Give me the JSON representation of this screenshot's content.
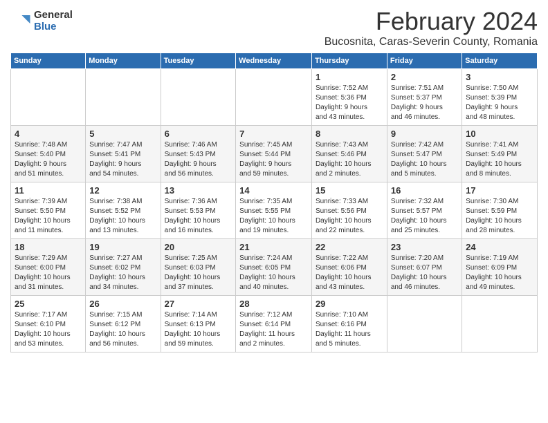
{
  "header": {
    "logo": {
      "general": "General",
      "blue": "Blue"
    },
    "title": "February 2024",
    "subtitle": "Bucosnita, Caras-Severin County, Romania"
  },
  "calendar": {
    "days": [
      "Sunday",
      "Monday",
      "Tuesday",
      "Wednesday",
      "Thursday",
      "Friday",
      "Saturday"
    ],
    "weeks": [
      {
        "cells": [
          {
            "date": "",
            "info": ""
          },
          {
            "date": "",
            "info": ""
          },
          {
            "date": "",
            "info": ""
          },
          {
            "date": "",
            "info": ""
          },
          {
            "date": "1",
            "info": "Sunrise: 7:52 AM\nSunset: 5:36 PM\nDaylight: 9 hours\nand 43 minutes."
          },
          {
            "date": "2",
            "info": "Sunrise: 7:51 AM\nSunset: 5:37 PM\nDaylight: 9 hours\nand 46 minutes."
          },
          {
            "date": "3",
            "info": "Sunrise: 7:50 AM\nSunset: 5:39 PM\nDaylight: 9 hours\nand 48 minutes."
          }
        ]
      },
      {
        "cells": [
          {
            "date": "4",
            "info": "Sunrise: 7:48 AM\nSunset: 5:40 PM\nDaylight: 9 hours\nand 51 minutes."
          },
          {
            "date": "5",
            "info": "Sunrise: 7:47 AM\nSunset: 5:41 PM\nDaylight: 9 hours\nand 54 minutes."
          },
          {
            "date": "6",
            "info": "Sunrise: 7:46 AM\nSunset: 5:43 PM\nDaylight: 9 hours\nand 56 minutes."
          },
          {
            "date": "7",
            "info": "Sunrise: 7:45 AM\nSunset: 5:44 PM\nDaylight: 9 hours\nand 59 minutes."
          },
          {
            "date": "8",
            "info": "Sunrise: 7:43 AM\nSunset: 5:46 PM\nDaylight: 10 hours\nand 2 minutes."
          },
          {
            "date": "9",
            "info": "Sunrise: 7:42 AM\nSunset: 5:47 PM\nDaylight: 10 hours\nand 5 minutes."
          },
          {
            "date": "10",
            "info": "Sunrise: 7:41 AM\nSunset: 5:49 PM\nDaylight: 10 hours\nand 8 minutes."
          }
        ]
      },
      {
        "cells": [
          {
            "date": "11",
            "info": "Sunrise: 7:39 AM\nSunset: 5:50 PM\nDaylight: 10 hours\nand 11 minutes."
          },
          {
            "date": "12",
            "info": "Sunrise: 7:38 AM\nSunset: 5:52 PM\nDaylight: 10 hours\nand 13 minutes."
          },
          {
            "date": "13",
            "info": "Sunrise: 7:36 AM\nSunset: 5:53 PM\nDaylight: 10 hours\nand 16 minutes."
          },
          {
            "date": "14",
            "info": "Sunrise: 7:35 AM\nSunset: 5:55 PM\nDaylight: 10 hours\nand 19 minutes."
          },
          {
            "date": "15",
            "info": "Sunrise: 7:33 AM\nSunset: 5:56 PM\nDaylight: 10 hours\nand 22 minutes."
          },
          {
            "date": "16",
            "info": "Sunrise: 7:32 AM\nSunset: 5:57 PM\nDaylight: 10 hours\nand 25 minutes."
          },
          {
            "date": "17",
            "info": "Sunrise: 7:30 AM\nSunset: 5:59 PM\nDaylight: 10 hours\nand 28 minutes."
          }
        ]
      },
      {
        "cells": [
          {
            "date": "18",
            "info": "Sunrise: 7:29 AM\nSunset: 6:00 PM\nDaylight: 10 hours\nand 31 minutes."
          },
          {
            "date": "19",
            "info": "Sunrise: 7:27 AM\nSunset: 6:02 PM\nDaylight: 10 hours\nand 34 minutes."
          },
          {
            "date": "20",
            "info": "Sunrise: 7:25 AM\nSunset: 6:03 PM\nDaylight: 10 hours\nand 37 minutes."
          },
          {
            "date": "21",
            "info": "Sunrise: 7:24 AM\nSunset: 6:05 PM\nDaylight: 10 hours\nand 40 minutes."
          },
          {
            "date": "22",
            "info": "Sunrise: 7:22 AM\nSunset: 6:06 PM\nDaylight: 10 hours\nand 43 minutes."
          },
          {
            "date": "23",
            "info": "Sunrise: 7:20 AM\nSunset: 6:07 PM\nDaylight: 10 hours\nand 46 minutes."
          },
          {
            "date": "24",
            "info": "Sunrise: 7:19 AM\nSunset: 6:09 PM\nDaylight: 10 hours\nand 49 minutes."
          }
        ]
      },
      {
        "cells": [
          {
            "date": "25",
            "info": "Sunrise: 7:17 AM\nSunset: 6:10 PM\nDaylight: 10 hours\nand 53 minutes."
          },
          {
            "date": "26",
            "info": "Sunrise: 7:15 AM\nSunset: 6:12 PM\nDaylight: 10 hours\nand 56 minutes."
          },
          {
            "date": "27",
            "info": "Sunrise: 7:14 AM\nSunset: 6:13 PM\nDaylight: 10 hours\nand 59 minutes."
          },
          {
            "date": "28",
            "info": "Sunrise: 7:12 AM\nSunset: 6:14 PM\nDaylight: 11 hours\nand 2 minutes."
          },
          {
            "date": "29",
            "info": "Sunrise: 7:10 AM\nSunset: 6:16 PM\nDaylight: 11 hours\nand 5 minutes."
          },
          {
            "date": "",
            "info": ""
          },
          {
            "date": "",
            "info": ""
          }
        ]
      }
    ]
  }
}
